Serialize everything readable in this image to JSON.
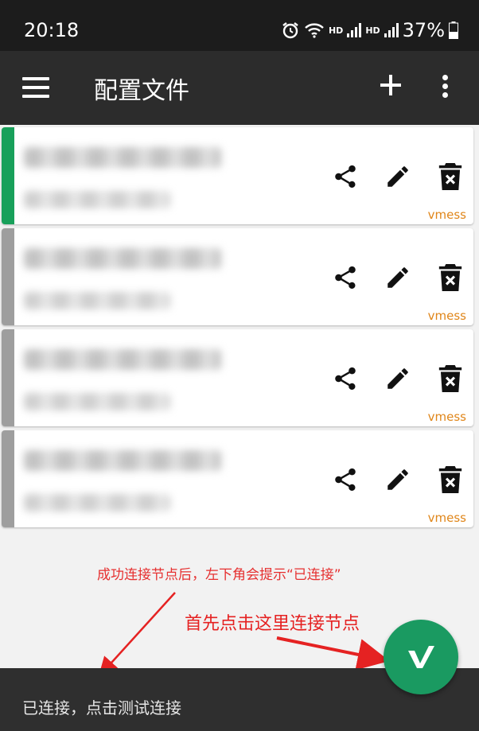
{
  "status_bar": {
    "time": "20:18",
    "hd1": "HD",
    "hd2": "HD",
    "battery": "37%",
    "icons": [
      "alarm-icon",
      "wifi-icon",
      "signal-icon",
      "signal-icon",
      "battery-icon"
    ]
  },
  "app_bar": {
    "title": "配置文件",
    "icons": [
      "menu-icon",
      "add-icon",
      "more-vert-icon"
    ]
  },
  "cards": [
    {
      "type_label": "vmess",
      "selected": true,
      "bar_color": "#18a05a"
    },
    {
      "type_label": "vmess",
      "selected": false,
      "bar_color": "#9e9e9e"
    },
    {
      "type_label": "vmess",
      "selected": false,
      "bar_color": "#9e9e9e"
    },
    {
      "type_label": "vmess",
      "selected": false,
      "bar_color": "#9e9e9e"
    }
  ],
  "card_actions": [
    "share-icon",
    "edit-icon",
    "delete-icon"
  ],
  "bottom_bar": {
    "status_text": "已连接，点击测试连接"
  },
  "fab": {
    "icon": "v-logo-icon",
    "color": "#1a9a61"
  },
  "annotations": {
    "hint_top": "成功连接节点后，左下角会提示“已连接”",
    "hint_fab": "首先点击这里连接节点",
    "color": "#e52222"
  },
  "colors": {
    "accent": "#e0861a",
    "app_bar": "#2c2c2c",
    "status_bar": "#1c1c1c"
  }
}
